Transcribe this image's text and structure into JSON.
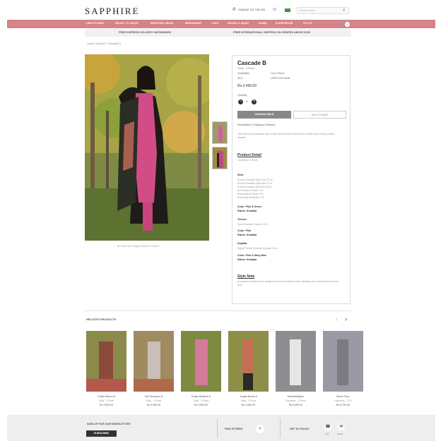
{
  "header": {
    "logo": "SAPPHIRE",
    "phone": "+92(0)42 111 738 245",
    "search_placeholder": "Search here"
  },
  "nav": {
    "items": [
      "UNSTITCHED",
      "READY TO WEAR",
      "WESTERN WEAR",
      "MENSWEAR",
      "KIDS",
      "SHOES & BAGS",
      "HOME",
      "SLEEPWEAR",
      "STYLE"
    ],
    "cart_count": "0"
  },
  "promo": {
    "left": "FREE EXPRESS DELIVERY NATIONWIDE",
    "right": "FREE INTERNATIONAL SHIPPING ON ORDERS ABOVE $150"
  },
  "breadcrumb": "Home  /  Women  /  Cascade B",
  "gallery": {
    "zoom_note": "Click the image with the cursor"
  },
  "product": {
    "title": "Cascade B",
    "subtitle": "Daily - 3 Piece",
    "availability_label": "Availability",
    "availability_value": "Out of Stock",
    "sku_label": "SKU",
    "sku_value": "U3PDY22V19BB",
    "price": "Rs.3,490.00",
    "quantity_label": "Quantity",
    "quantity_value": "1",
    "unavailable_btn": "UNAVAILABLE",
    "buy_btn": "BUY IT NOW",
    "tabs": "Description  |  Shipping  |  Returns",
    "description": "This vibrant pink khaddar look comes with feminine embroidered motifs and a boldly printed dupatta.",
    "detail_heading": "Product Detail",
    "detail_sub": "Unstitched 3 Piece",
    "shirt_label": "Shirt",
    "shirt_lines": [
      "Printed Khaddar Shirt Front 31 in",
      "Printed Khaddar Shirt Back 37 in",
      "Printed Khaddar Sleeves 0.66 m",
      "Embroidered Patch 1 Pc",
      "Embroidered Patch 2 Pc",
      "Embroidered Border 1 Pc"
    ],
    "shirt_color": "Color: Pink & Green",
    "shirt_fabric": "Fabric: Khaddar",
    "trouser_label": "Trouser",
    "trouser_lines": [
      "Dyed Khaddar Trouser 2.5 m"
    ],
    "trouser_color": "Color: Pink",
    "trouser_fabric": "Fabric: Khaddar",
    "dupatta_label": "Dupatta",
    "dupatta_lines": [
      "Digital Printed Khaddar Dupatta 2.5 m"
    ],
    "dupatta_color": "Color: Pink & Navy Blue",
    "dupatta_fabric": "Fabric: Khaddar",
    "style_heading": "Style Note",
    "style_text": "A buttoned pleated kurta, straight trousers and added tassel detailing are recommended for this look."
  },
  "related": {
    "title": "RELATED PRODUCTS",
    "cards": [
      {
        "name": "Coffee Bloom B",
        "sub": "Daily - 3 Piece",
        "price": "Rs.3,990.00"
      },
      {
        "name": "Soft Shadows B",
        "sub": "Daily - 3 Piece",
        "price": "Rs.3,990.00"
      },
      {
        "name": "Dusty Meadow A",
        "sub": "Daily - 3 Piece",
        "price": "Rs.3,590.00"
      },
      {
        "name": "Jungle Bloom A",
        "sub": "Daily - 3 Piece",
        "price": "Rs.3,590.00"
      },
      {
        "name": "Michaelangelo",
        "sub": "Signature - 3 Piece",
        "price": "Rs.8,490.00"
      },
      {
        "name": "Moon Glow",
        "sub": "Signature - 3 Pc",
        "price": "Rs.8,790.00"
      }
    ]
  },
  "footer": {
    "newsletter": "SIGN UP FOR OUR NEWSLETTER",
    "subscribe": "SUBSCRIBE",
    "find_stores": "FIND STORES",
    "get_in_touch": "GET IN TOUCH",
    "call": "Call",
    "email": "Email"
  },
  "colors": {
    "brand_pink": "#d48488",
    "dark": "#333333"
  }
}
